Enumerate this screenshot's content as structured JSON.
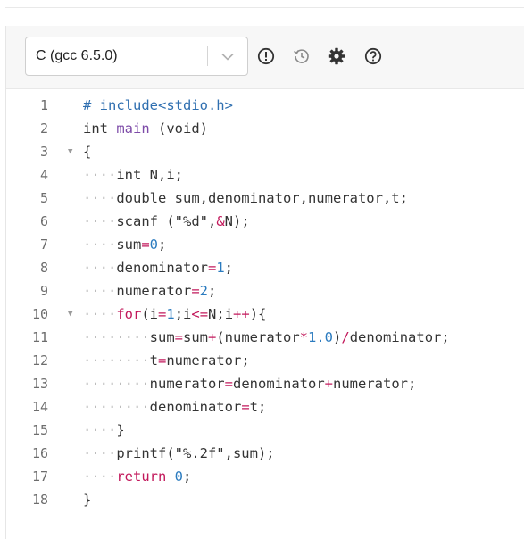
{
  "toolbar": {
    "language_selected": "C (gcc 6.5.0)",
    "icons": [
      "chevron-down-icon",
      "alert-icon",
      "history-icon",
      "gear-icon",
      "help-icon"
    ]
  },
  "code": {
    "lines": [
      {
        "number": "1",
        "fold": false,
        "tokens": [
          [
            "pre",
            "# include<stdio.h>"
          ]
        ]
      },
      {
        "number": "2",
        "fold": false,
        "tokens": [
          [
            "kw",
            "int "
          ],
          [
            "fn",
            "main"
          ],
          [
            "kw",
            " (void)"
          ]
        ]
      },
      {
        "number": "3",
        "fold": true,
        "tokens": [
          [
            "kw",
            "{"
          ]
        ]
      },
      {
        "number": "4",
        "fold": false,
        "tokens": [
          [
            "ws",
            "····"
          ],
          [
            "kw",
            "int N,i;"
          ]
        ]
      },
      {
        "number": "5",
        "fold": false,
        "tokens": [
          [
            "ws",
            "····"
          ],
          [
            "kw",
            "double sum,denominator,numerator,t;"
          ]
        ]
      },
      {
        "number": "6",
        "fold": false,
        "tokens": [
          [
            "ws",
            "····"
          ],
          [
            "kw",
            "scanf (\"%d\","
          ],
          [
            "op",
            "&"
          ],
          [
            "kw",
            "N);"
          ]
        ]
      },
      {
        "number": "7",
        "fold": false,
        "tokens": [
          [
            "ws",
            "····"
          ],
          [
            "kw",
            "sum"
          ],
          [
            "op",
            "="
          ],
          [
            "num",
            "0"
          ],
          [
            "kw",
            ";"
          ]
        ]
      },
      {
        "number": "8",
        "fold": false,
        "tokens": [
          [
            "ws",
            "····"
          ],
          [
            "kw",
            "denominator"
          ],
          [
            "op",
            "="
          ],
          [
            "num",
            "1"
          ],
          [
            "kw",
            ";"
          ]
        ]
      },
      {
        "number": "9",
        "fold": false,
        "tokens": [
          [
            "ws",
            "····"
          ],
          [
            "kw",
            "numerator"
          ],
          [
            "op",
            "="
          ],
          [
            "num",
            "2"
          ],
          [
            "kw",
            ";"
          ]
        ]
      },
      {
        "number": "10",
        "fold": true,
        "tokens": [
          [
            "ws",
            "····"
          ],
          [
            "ctl",
            "for"
          ],
          [
            "kw",
            "(i"
          ],
          [
            "op",
            "="
          ],
          [
            "num",
            "1"
          ],
          [
            "kw",
            ";i"
          ],
          [
            "op",
            "<="
          ],
          [
            "kw",
            "N;i"
          ],
          [
            "op",
            "++"
          ],
          [
            "kw",
            "){"
          ]
        ]
      },
      {
        "number": "11",
        "fold": false,
        "tokens": [
          [
            "ws",
            "········"
          ],
          [
            "kw",
            "sum"
          ],
          [
            "op",
            "="
          ],
          [
            "kw",
            "sum"
          ],
          [
            "op",
            "+"
          ],
          [
            "kw",
            "(numerator"
          ],
          [
            "op",
            "*"
          ],
          [
            "num",
            "1.0"
          ],
          [
            "kw",
            ")"
          ],
          [
            "op",
            "/"
          ],
          [
            "kw",
            "denominator;"
          ]
        ]
      },
      {
        "number": "12",
        "fold": false,
        "tokens": [
          [
            "ws",
            "········"
          ],
          [
            "kw",
            "t"
          ],
          [
            "op",
            "="
          ],
          [
            "kw",
            "numerator;"
          ]
        ]
      },
      {
        "number": "13",
        "fold": false,
        "tokens": [
          [
            "ws",
            "········"
          ],
          [
            "kw",
            "numerator"
          ],
          [
            "op",
            "="
          ],
          [
            "kw",
            "denominator"
          ],
          [
            "op",
            "+"
          ],
          [
            "kw",
            "numerator;"
          ]
        ]
      },
      {
        "number": "14",
        "fold": false,
        "tokens": [
          [
            "ws",
            "········"
          ],
          [
            "kw",
            "denominator"
          ],
          [
            "op",
            "="
          ],
          [
            "kw",
            "t;"
          ]
        ]
      },
      {
        "number": "15",
        "fold": false,
        "tokens": [
          [
            "ws",
            "····"
          ],
          [
            "kw",
            "}"
          ]
        ]
      },
      {
        "number": "16",
        "fold": false,
        "tokens": [
          [
            "ws",
            "····"
          ],
          [
            "kw",
            "printf(\"%.2f\",sum);"
          ]
        ]
      },
      {
        "number": "17",
        "fold": false,
        "tokens": [
          [
            "ws",
            "····"
          ],
          [
            "ctl",
            "return"
          ],
          [
            "kw",
            " "
          ],
          [
            "num",
            "0"
          ],
          [
            "kw",
            ";"
          ]
        ]
      },
      {
        "number": "18",
        "fold": false,
        "tokens": [
          [
            "kw",
            "}"
          ]
        ]
      }
    ]
  }
}
